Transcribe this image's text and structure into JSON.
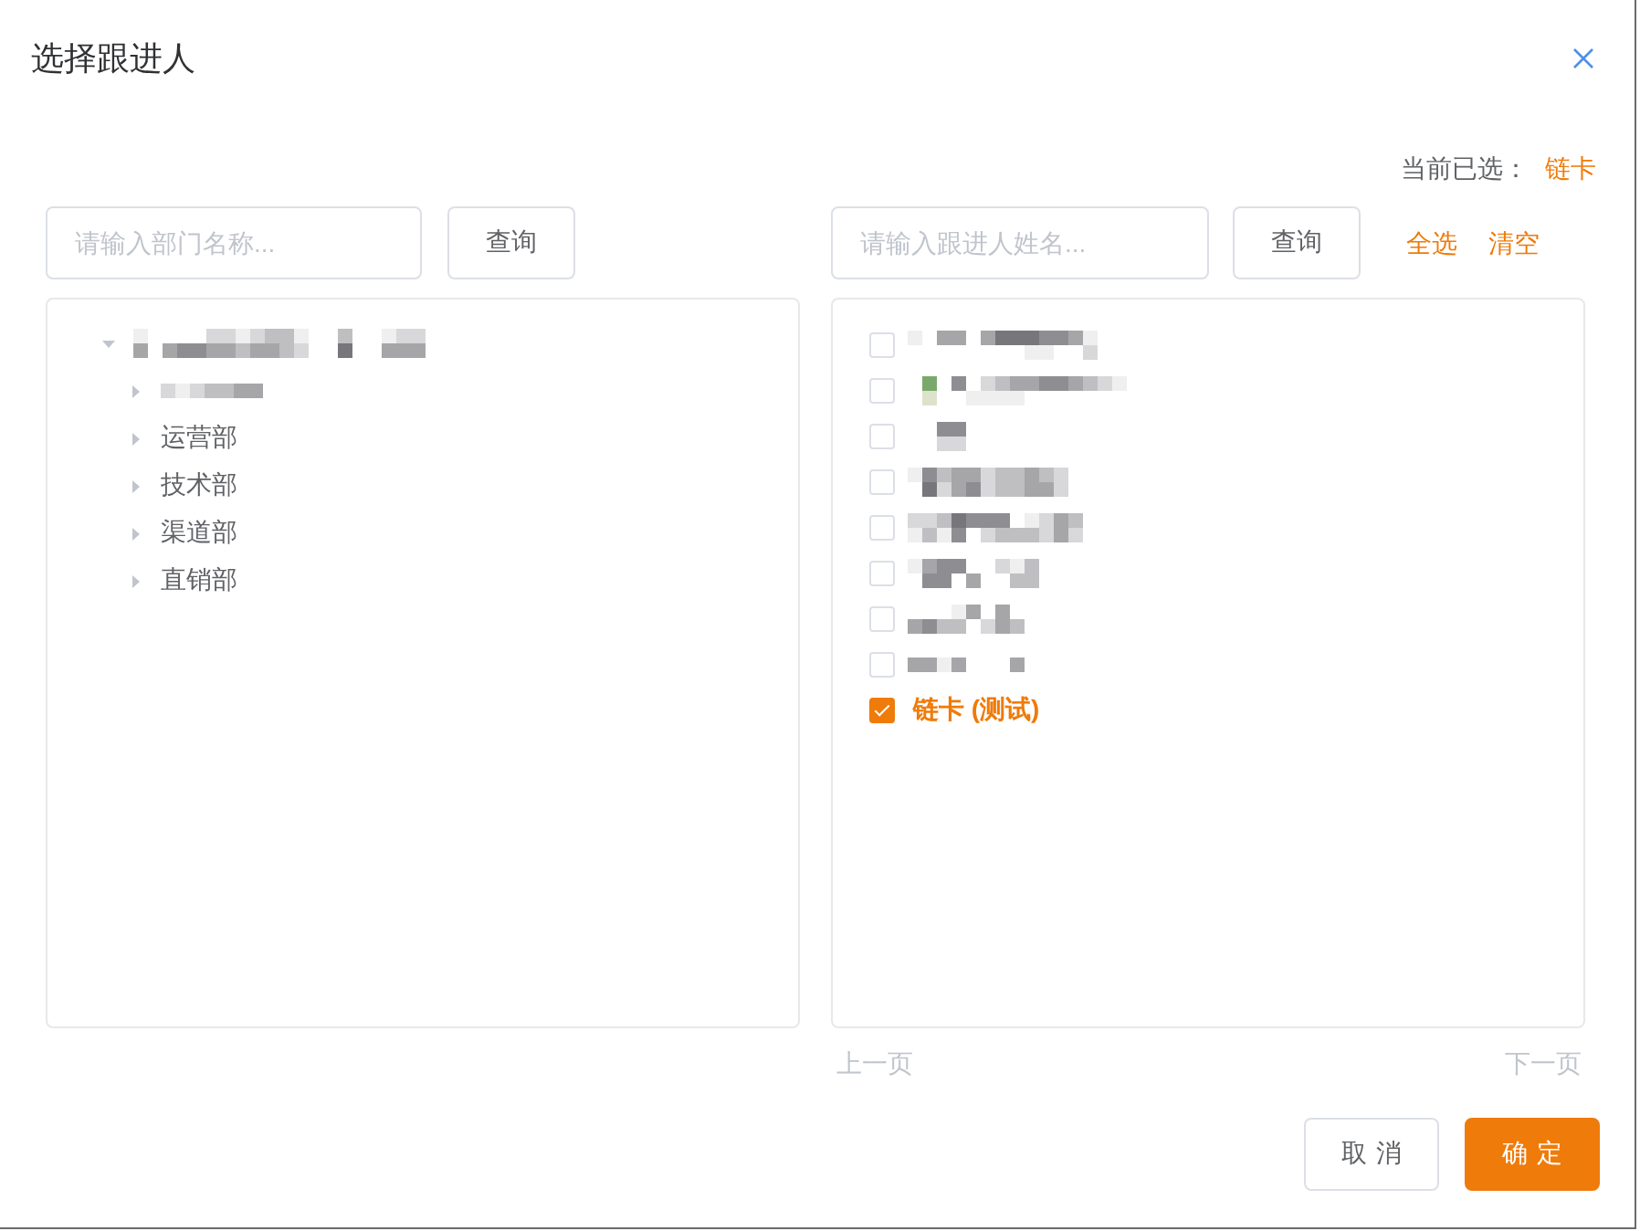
{
  "dialog": {
    "title": "选择跟进人"
  },
  "current_selection": {
    "label": "当前已选：",
    "value": "链卡"
  },
  "department_search": {
    "placeholder": "请输入部门名称...",
    "button": "查询"
  },
  "department_tree": [
    {
      "kind": "redacted",
      "expanded": true,
      "children": [
        {
          "kind": "redacted",
          "expanded": false
        },
        {
          "kind": "text",
          "label": "运营部",
          "expanded": false
        },
        {
          "kind": "text",
          "label": "技术部",
          "expanded": false
        },
        {
          "kind": "text",
          "label": "渠道部",
          "expanded": false
        },
        {
          "kind": "text",
          "label": "直销部",
          "expanded": false
        }
      ]
    }
  ],
  "person_search": {
    "placeholder": "请输入跟进人姓名...",
    "button": "查询",
    "actions": [
      "全选",
      "清空"
    ]
  },
  "person_list": [
    {
      "kind": "redacted",
      "checked": false
    },
    {
      "kind": "redacted",
      "checked": false
    },
    {
      "kind": "redacted",
      "checked": false
    },
    {
      "kind": "redacted",
      "checked": false
    },
    {
      "kind": "redacted",
      "checked": false
    },
    {
      "kind": "redacted",
      "checked": false
    },
    {
      "kind": "redacted",
      "checked": false
    },
    {
      "kind": "redacted",
      "checked": false
    },
    {
      "kind": "text",
      "label": "链卡 (测试)",
      "checked": true
    }
  ],
  "pagination": [
    {
      "label": "上一页",
      "disabled": true
    },
    {
      "label": "下一页",
      "disabled": true
    }
  ],
  "footer_buttons": [
    {
      "label": "取消",
      "kind": "secondary"
    },
    {
      "label": "确定",
      "kind": "primary"
    }
  ]
}
